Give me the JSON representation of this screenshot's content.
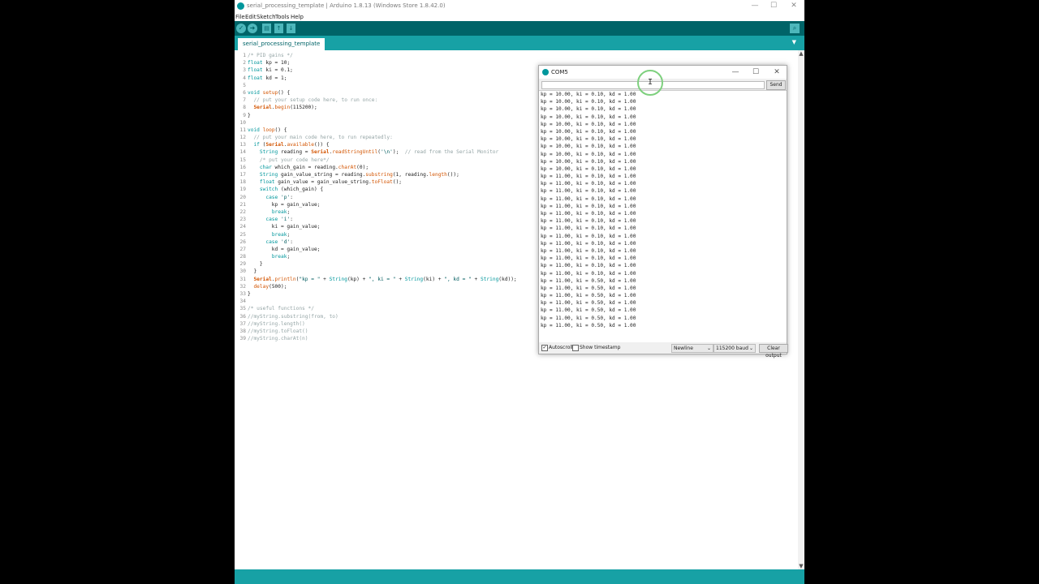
{
  "window": {
    "title": "serial_processing_template | Arduino 1.8.13 (Windows Store 1.8.42.0)",
    "controls": [
      "—",
      "☐",
      "✕"
    ]
  },
  "menu": [
    "File",
    "Edit",
    "Sketch",
    "Tools",
    "Help"
  ],
  "toolbar": {
    "verify": "✓",
    "upload": "➜",
    "new": "▤",
    "open": "↑",
    "save": "↓",
    "serial_monitor": "⌕"
  },
  "tab": {
    "name": "serial_processing_template",
    "menu_arrow": "▼"
  },
  "code_lines": [
    "/* PID gains */",
    "float kp = 10;",
    "float ki = 0.1;",
    "float kd = 1;",
    "",
    "void setup() {",
    "  // put your setup code here, to run once:",
    "  Serial.begin(115200);",
    "}",
    "",
    "void loop() {",
    "  // put your main code here, to run repeatedly:",
    "  if (Serial.available()) {",
    "    String reading = Serial.readStringUntil('\\n');  // read from the Serial Monitor",
    "    /* put your code here*/",
    "    char which_gain = reading.charAt(0);",
    "    String gain_value_string = reading.substring(1, reading.length());",
    "    float gain_value = gain_value_string.toFloat();",
    "    switch (which_gain) {",
    "      case 'p':",
    "        kp = gain_value;",
    "        break;",
    "      case 'i':",
    "        ki = gain_value;",
    "        break;",
    "      case 'd':",
    "        kd = gain_value;",
    "        break;",
    "    }",
    "  }",
    "  Serial.println(\"kp = \" + String(kp) + \", ki = \" + String(ki) + \", kd = \" + String(kd));",
    "  delay(500);",
    "}",
    "",
    "/* useful functions */",
    "//myString.substring(from, to)",
    "//myString.length()",
    "//myString.toFloat()",
    "//myString.charAt(n)"
  ],
  "serial_monitor": {
    "title": "COM5",
    "controls": [
      "—",
      "☐",
      "✕"
    ],
    "input_value": "",
    "send_label": "Send",
    "output_lines": [
      "kp = 10.00, ki = 0.10, kd = 1.00",
      "kp = 10.00, ki = 0.10, kd = 1.00",
      "kp = 10.00, ki = 0.10, kd = 1.00",
      "kp = 10.00, ki = 0.10, kd = 1.00",
      "kp = 10.00, ki = 0.10, kd = 1.00",
      "kp = 10.00, ki = 0.10, kd = 1.00",
      "kp = 10.00, ki = 0.10, kd = 1.00",
      "kp = 10.00, ki = 0.10, kd = 1.00",
      "kp = 10.00, ki = 0.10, kd = 1.00",
      "kp = 10.00, ki = 0.10, kd = 1.00",
      "kp = 10.00, ki = 0.10, kd = 1.00",
      "kp = 11.00, ki = 0.10, kd = 1.00",
      "kp = 11.00, ki = 0.10, kd = 1.00",
      "kp = 11.00, ki = 0.10, kd = 1.00",
      "kp = 11.00, ki = 0.10, kd = 1.00",
      "kp = 11.00, ki = 0.10, kd = 1.00",
      "kp = 11.00, ki = 0.10, kd = 1.00",
      "kp = 11.00, ki = 0.10, kd = 1.00",
      "kp = 11.00, ki = 0.10, kd = 1.00",
      "kp = 11.00, ki = 0.10, kd = 1.00",
      "kp = 11.00, ki = 0.10, kd = 1.00",
      "kp = 11.00, ki = 0.10, kd = 1.00",
      "kp = 11.00, ki = 0.10, kd = 1.00",
      "kp = 11.00, ki = 0.10, kd = 1.00",
      "kp = 11.00, ki = 0.10, kd = 1.00",
      "kp = 11.00, ki = 0.50, kd = 1.00",
      "kp = 11.00, ki = 0.50, kd = 1.00",
      "kp = 11.00, ki = 0.50, kd = 1.00",
      "kp = 11.00, ki = 0.50, kd = 1.00",
      "kp = 11.00, ki = 0.50, kd = 1.00",
      "kp = 11.00, ki = 0.50, kd = 1.00",
      "kp = 11.00, ki = 0.50, kd = 1.00"
    ],
    "autoscroll_label": "Autoscroll",
    "autoscroll_checked": true,
    "timestamp_label": "Show timestamp",
    "timestamp_checked": false,
    "line_ending": "Newline",
    "baud": "115200 baud",
    "clear_label": "Clear output"
  },
  "colors": {
    "toolbar": "#006468",
    "tabbar": "#17a1a5",
    "accent": "#00979c"
  }
}
